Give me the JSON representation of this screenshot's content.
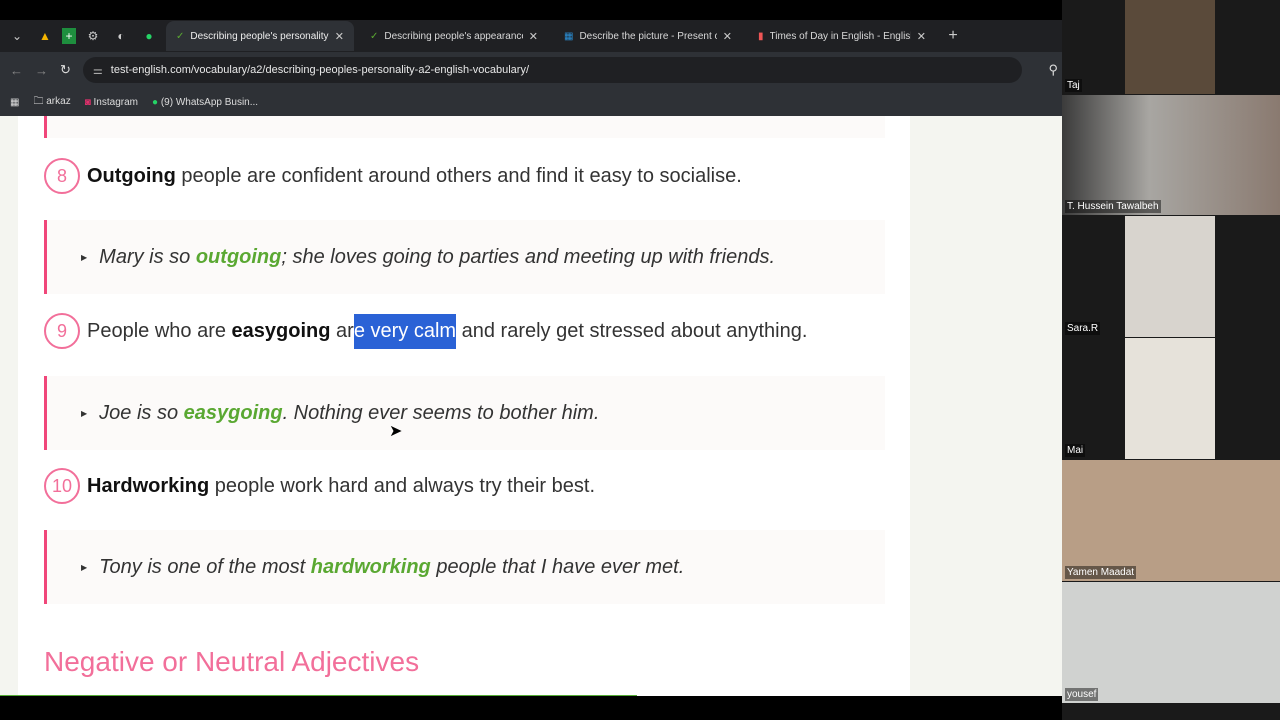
{
  "browser": {
    "tabs": [
      {
        "title": "Describing people's personality",
        "active": true
      },
      {
        "title": "Describing people's appearance",
        "active": false
      },
      {
        "title": "Describe the picture - Present c",
        "active": false
      },
      {
        "title": "Times of Day in English - English",
        "active": false
      }
    ],
    "close_glyph": "✕",
    "new_tab": "+",
    "url": "test-english.com/vocabulary/a2/describing-peoples-personality-a2-english-vocabulary/",
    "bookmarks": [
      "arkaz",
      "Instagram",
      "(9) WhatsApp Busin..."
    ]
  },
  "content": {
    "items": [
      {
        "num": "8",
        "word": "Outgoing",
        "rest": " people are confident around others and find it easy to socialise.",
        "example": {
          "pre": "Mary is so ",
          "word": "outgoing",
          "post": "; she loves going to parties and meeting up with friends."
        }
      },
      {
        "num": "9",
        "pre": "People who are ",
        "word": "easygoing",
        "mid": " ar",
        "highlight": "e very calm",
        "rest": " and rarely get stressed about anything.",
        "example": {
          "pre": "Joe is so ",
          "word": "easygoing",
          "post": ". Nothing ever seems to bother him."
        }
      },
      {
        "num": "10",
        "word": "Hardworking",
        "rest": " people work hard and always try their best.",
        "example": {
          "pre": "Tony is one of the most ",
          "word": "hardworking",
          "post": " people that I have ever met."
        }
      }
    ],
    "section_heading": "Negative or Neutral Adjectives",
    "reading_progress_percent": 60
  },
  "participants": [
    "Taj",
    "T. Hussein Tawalbeh",
    "Sara.R",
    "Mai",
    "Yamen Maadat",
    "yousef"
  ]
}
